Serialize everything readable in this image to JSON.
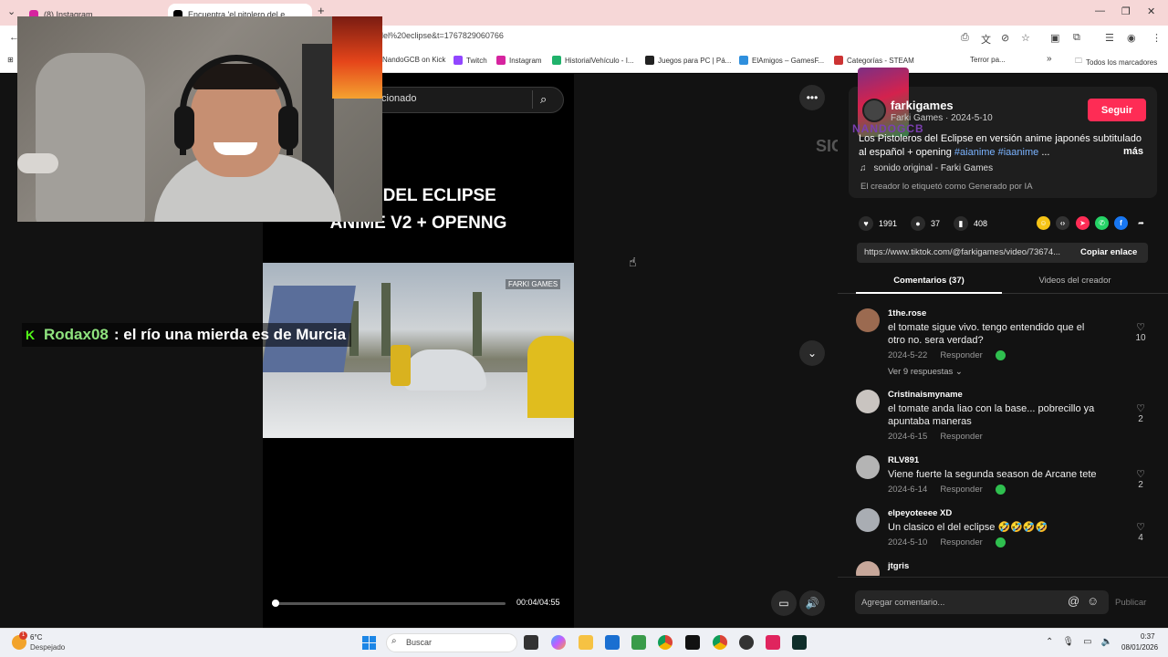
{
  "browser": {
    "tabs": [
      {
        "label": "(8) Instagram",
        "active": false
      },
      {
        "label": "Encuentra 'el pitolero del e",
        "active": true
      }
    ],
    "new_tab": "+",
    "url": "0del%20eclipse&t=1767829060766",
    "bookmarks": [
      "NandoGCB on Kick",
      "Twitch",
      "Instagram",
      "HistorialVehículo - I...",
      "Juegos para PC | Pá...",
      "ElAmigos – GamesF...",
      "Categorías - STEAM",
      "Terror pa..."
    ],
    "bookmarks_more": "»",
    "all_bookmarks": "Todos los marcadores"
  },
  "video": {
    "search_text": "cionado",
    "title_line1": "ROS DEL ECLIPSE",
    "title_line2": "ANIME V2 + OPENNG",
    "watermark": "FARKI GAMES",
    "time": "00:04/04:55",
    "progress": 0.014,
    "ghost_text": "SIGU"
  },
  "stream": {
    "chat_user": "Rodax08",
    "chat_sep": ":",
    "chat_message": "el río una mierda es de Murcia"
  },
  "creator": {
    "name": "farkigames",
    "subline": "Farki Games · 2024-5-10",
    "follow": "Seguir",
    "overlay_text": "NANDOGCB",
    "description": "Los Pistoleros del Eclipse en versión anime japonés subtitulado al español + opening ",
    "tags": [
      "#aianime",
      "#iaanime"
    ],
    "ellipsis": "...",
    "more": "más",
    "music": "sonido original - Farki Games",
    "ai_label": "El creador lo etiquetó como Generado por IA"
  },
  "stats": {
    "likes": "1991",
    "comments": "37",
    "saves": "408"
  },
  "link": {
    "url": "https://www.tiktok.com/@farkigames/video/73674...",
    "copy": "Copiar enlace"
  },
  "panel_tabs": {
    "comments": "Comentarios (37)",
    "creator_videos": "Videos del creador"
  },
  "comments": [
    {
      "user": "1the.rose",
      "text": "el tomate sigue vivo. tengo entendido que el otro no. sera verdad?",
      "date": "2024-5-22",
      "reply": "Responder",
      "likes": "10",
      "replies": "Ver 9 respuestas ⌄"
    },
    {
      "user": "Cristinaismyname",
      "text": "el tomate anda liao con la base... pobrecillo ya apuntaba maneras",
      "date": "2024-6-15",
      "reply": "Responder",
      "likes": "2"
    },
    {
      "user": "RLV891",
      "text": "Viene fuerte la segunda season de Arcane tete",
      "date": "2024-6-14",
      "reply": "Responder",
      "likes": "2"
    },
    {
      "user": "elpeyoteeee XD",
      "text": "Un clasico el del eclipse 🤣🤣🤣🤣",
      "date": "2024-5-10",
      "reply": "Responder",
      "likes": "4"
    },
    {
      "user": "jtgris",
      "text": "",
      "date": "",
      "reply": "",
      "likes": ""
    }
  ],
  "add_comment": {
    "placeholder": "Agregar comentario...",
    "publish": "Publicar"
  },
  "taskbar": {
    "weather_temp": "6°C",
    "weather_desc": "Despejado",
    "weather_badge": "1",
    "search": "Buscar",
    "time": "0:37",
    "date": "08/01/2026"
  },
  "colors": {
    "accent": "#fe2c55",
    "tag": "#7ab3ff",
    "kick_green": "#53fc18",
    "chat_user": "#8fe37e"
  }
}
